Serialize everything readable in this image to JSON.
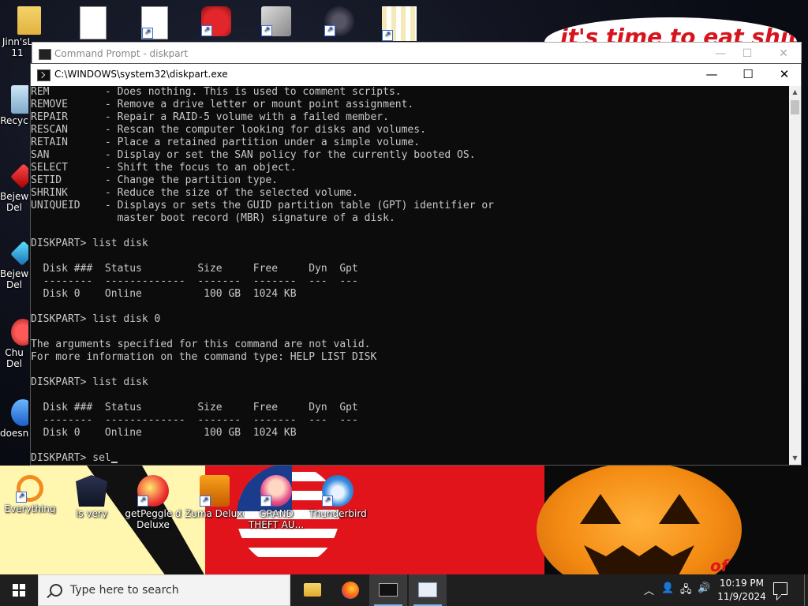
{
  "desktop": {
    "top_icons": [
      {
        "label": "Jinn'sL",
        "label2": "11"
      },
      {
        "label": ""
      },
      {
        "label": ""
      },
      {
        "label": ""
      },
      {
        "label": ""
      },
      {
        "label": ""
      },
      {
        "label": ""
      }
    ],
    "left_icons": [
      {
        "label": "Recyc"
      },
      {
        "label": "Bejew",
        "label2": "Del"
      },
      {
        "label": "Bejew",
        "label2": "Del"
      },
      {
        "label": "Chu",
        "label2": "Del"
      },
      {
        "label": "doesn"
      }
    ],
    "bottom_icons": [
      {
        "label": "Everything"
      },
      {
        "label": "is very"
      },
      {
        "label": "getPeggle d",
        "label2": "Deluxe"
      },
      {
        "label": "Zuma Deluxe"
      },
      {
        "label": "GRAND",
        "label2": "THEFT AU..."
      },
      {
        "label": "Thunderbird"
      }
    ],
    "wallpaper_text": "it's time to eat shit",
    "wallpaper_text2": "of"
  },
  "back_window": {
    "title": "Command Prompt - diskpart"
  },
  "window": {
    "title": "C:\\WINDOWS\\system32\\diskpart.exe",
    "minimize": "—",
    "maximize": "☐",
    "close": "✕"
  },
  "console": {
    "text": "REM         - Does nothing. This is used to comment scripts.\nREMOVE      - Remove a drive letter or mount point assignment.\nREPAIR      - Repair a RAID-5 volume with a failed member.\nRESCAN      - Rescan the computer looking for disks and volumes.\nRETAIN      - Place a retained partition under a simple volume.\nSAN         - Display or set the SAN policy for the currently booted OS.\nSELECT      - Shift the focus to an object.\nSETID       - Change the partition type.\nSHRINK      - Reduce the size of the selected volume.\nUNIQUEID    - Displays or sets the GUID partition table (GPT) identifier or\n              master boot record (MBR) signature of a disk.\n\nDISKPART> list disk\n\n  Disk ###  Status         Size     Free     Dyn  Gpt\n  --------  -------------  -------  -------  ---  ---\n  Disk 0    Online          100 GB  1024 KB\n\nDISKPART> list disk 0\n\nThe arguments specified for this command are not valid.\nFor more information on the command type: HELP LIST DISK\n\nDISKPART> list disk\n\n  Disk ###  Status         Size     Free     Dyn  Gpt\n  --------  -------------  -------  -------  ---  ---\n  Disk 0    Online          100 GB  1024 KB\n\nDISKPART> sel"
  },
  "taskbar": {
    "search_placeholder": "Type here to search",
    "time": "10:19 PM",
    "date": "11/9/2024"
  },
  "colors": {
    "console_bg": "#0c0c0c",
    "console_fg": "#c8c8c8",
    "taskbar_bg": "#1f1f1f",
    "accent": "#76b9ed"
  }
}
